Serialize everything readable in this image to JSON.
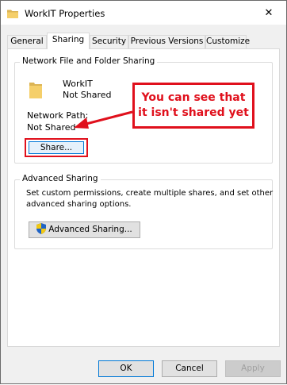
{
  "window": {
    "title": "WorkIT Properties",
    "close_glyph": "✕",
    "folder_icon": "folder-icon"
  },
  "tabs": [
    {
      "label": "General"
    },
    {
      "label": "Sharing",
      "active": true
    },
    {
      "label": "Security"
    },
    {
      "label": "Previous Versions"
    },
    {
      "label": "Customize"
    }
  ],
  "network_sharing": {
    "group_label": "Network File and Folder Sharing",
    "folder_name": "WorkIT",
    "status": "Not Shared",
    "path_label": "Network Path:",
    "path_value": "Not Shared",
    "share_button": "Share..."
  },
  "annotation": {
    "callout_line1": "You can see that",
    "callout_line2": "it isn't shared yet",
    "color": "#e0101c"
  },
  "advanced_sharing": {
    "group_label": "Advanced Sharing",
    "description_line1": "Set custom permissions, create multiple shares, and set other",
    "description_line2": "advanced sharing options.",
    "button": "Advanced Sharing...",
    "button_icon": "uac-shield-icon"
  },
  "footer": {
    "ok": "OK",
    "cancel": "Cancel",
    "apply": "Apply"
  }
}
